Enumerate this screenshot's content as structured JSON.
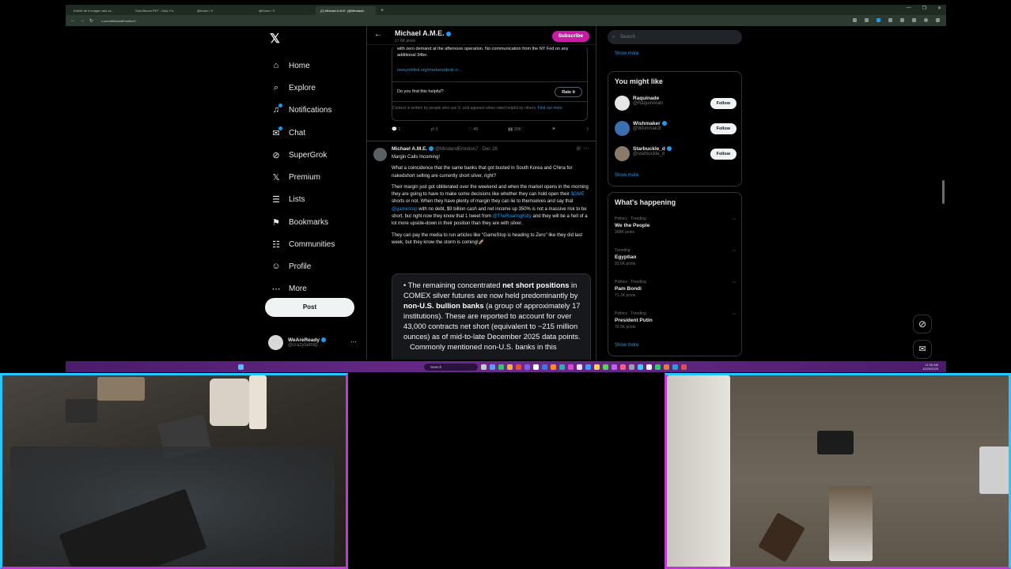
{
  "browser": {
    "tabs": [
      {
        "label": "EstVle de tl imagen and xa.."
      },
      {
        "label": "Gold Bloom PKT - Daw, Fe.."
      },
      {
        "label": "@rhuen / X"
      },
      {
        "label": "@rhuen / X"
      },
      {
        "label": "(2) Michael A.M.E. (@Mindand..",
        "active": true
      }
    ],
    "new_tab": "+",
    "window_controls": [
      "—",
      "❐",
      "✕"
    ],
    "url": "x.com/MindandEmotion7"
  },
  "x": {
    "logo": "𝕏",
    "nav": [
      {
        "label": "Home",
        "icon": "home-icon",
        "glyph": "⌂"
      },
      {
        "label": "Explore",
        "icon": "search-icon",
        "glyph": "⌕"
      },
      {
        "label": "Notifications",
        "icon": "bell-icon",
        "glyph": "♫",
        "dot": true
      },
      {
        "label": "Chat",
        "icon": "chat-icon",
        "glyph": "✉",
        "dot": true
      },
      {
        "label": "SuperGrok",
        "icon": "grok-icon",
        "glyph": "⊘"
      },
      {
        "label": "Premium",
        "icon": "x-premium-icon",
        "glyph": "𝕏"
      },
      {
        "label": "Lists",
        "icon": "list-icon",
        "glyph": "☰"
      },
      {
        "label": "Bookmarks",
        "icon": "bookmark-icon",
        "glyph": "⚑"
      },
      {
        "label": "Communities",
        "icon": "communities-icon",
        "glyph": "☷"
      },
      {
        "label": "Profile",
        "icon": "profile-icon",
        "glyph": "☺"
      },
      {
        "label": "More",
        "icon": "more-icon",
        "glyph": "⋯"
      }
    ],
    "post_button": "Post",
    "account": {
      "name": "WeAreReady",
      "handle": "@crazyfaithllp"
    },
    "header": {
      "title": "Michael A.M.E.",
      "subtitle": "17.6K posts",
      "subscribe": "Subscribe"
    },
    "note": {
      "text": "with zero demand at the afternoon operation. No communication from the NY Fed on any additional 34bn.",
      "link": "newyorkfed.org/markets/desk-o...",
      "helpful_q": "Do you find this helpful?",
      "rate": "Rate it",
      "context": "Context is written by people who use X, and appears when rated helpful by others.",
      "context_link": "Find out more"
    },
    "actions": {
      "replies": "1",
      "reposts": "5",
      "likes": "48",
      "views": "30K"
    },
    "tweet": {
      "name": "Michael A.M.E.",
      "handle": "@MindandEmotion7",
      "date": "· Dec 28",
      "p1": "Margin Calls Incoming!",
      "p2": "What a coincidence that the same banks that got busted in South Korea and China for nakedshort selling are currently short silver, right?",
      "p3a": "Their margin just got obliterated over the weekend and when the market opens in the morning they are going to have to make some decisions like whether they can hold open their ",
      "cashtag": "$GME",
      "p3b": " shorts or not. When they have plenty of margin they can lie to themselves and say that ",
      "mention1": "@gamestop",
      "p3c": " with no debt, $9 billion cash and net income up 350% is not a massive risk to be short, but right now they know that 1 tweet from ",
      "mention2": "@TheRoaringKitty",
      "p3d": " and they will be a hell of a lot more upside-down in their position than they are with silver.",
      "p4": "They can pay the media to run articles like \"GameStop is heading to Zero\" like they did last week, but they know the storm is coming!🚀"
    },
    "image": {
      "t1": "• The remaining concentrated ",
      "b1": "net short positions",
      "t2": " in COMEX silver futures are now held predominantly by ",
      "b2": "non-U.S. bullion banks",
      "t3": " (a group of approximately 17 institutions). These are reported to account for over 43,000 contracts net short (equivalent to ~215 million ounces) as of mid-to-late December 2025 data points.",
      "t4": "Commonly mentioned non-U.S. banks in this"
    },
    "search_placeholder": "Search",
    "show_more": "Show more",
    "you_might_like": {
      "title": "You might like",
      "follow": "Follow",
      "users": [
        {
          "name": "Raquinade",
          "handle": "@RaquinAlain",
          "verified": false
        },
        {
          "name": "Wishmaker",
          "handle": "@Wishmak3r",
          "verified": true
        },
        {
          "name": "Starbuckle_d",
          "handle": "@starbuckle_d",
          "verified": true
        }
      ]
    },
    "whats_happening": {
      "title": "What's happening",
      "trends": [
        {
          "category": "Politics · Trending",
          "name": "We the People",
          "count": "368K posts"
        },
        {
          "category": "Trending",
          "name": "Egyptian",
          "count": "93.6K posts"
        },
        {
          "category": "Politics · Trending",
          "name": "Pam Bondi",
          "count": "71.1K posts"
        },
        {
          "category": "Politics · Trending",
          "name": "President Putin",
          "count": "75.5K posts"
        }
      ]
    }
  },
  "taskbar": {
    "search": "Search",
    "time": "11:36 AM",
    "date": "12/29/2025"
  },
  "colors": {
    "accent": "#1d9bf0",
    "subscribe": "#c91ba8",
    "taskbar": "#6b2a8a",
    "cam_frame_a": "#28c6ff",
    "cam_frame_b": "#c039d8"
  }
}
